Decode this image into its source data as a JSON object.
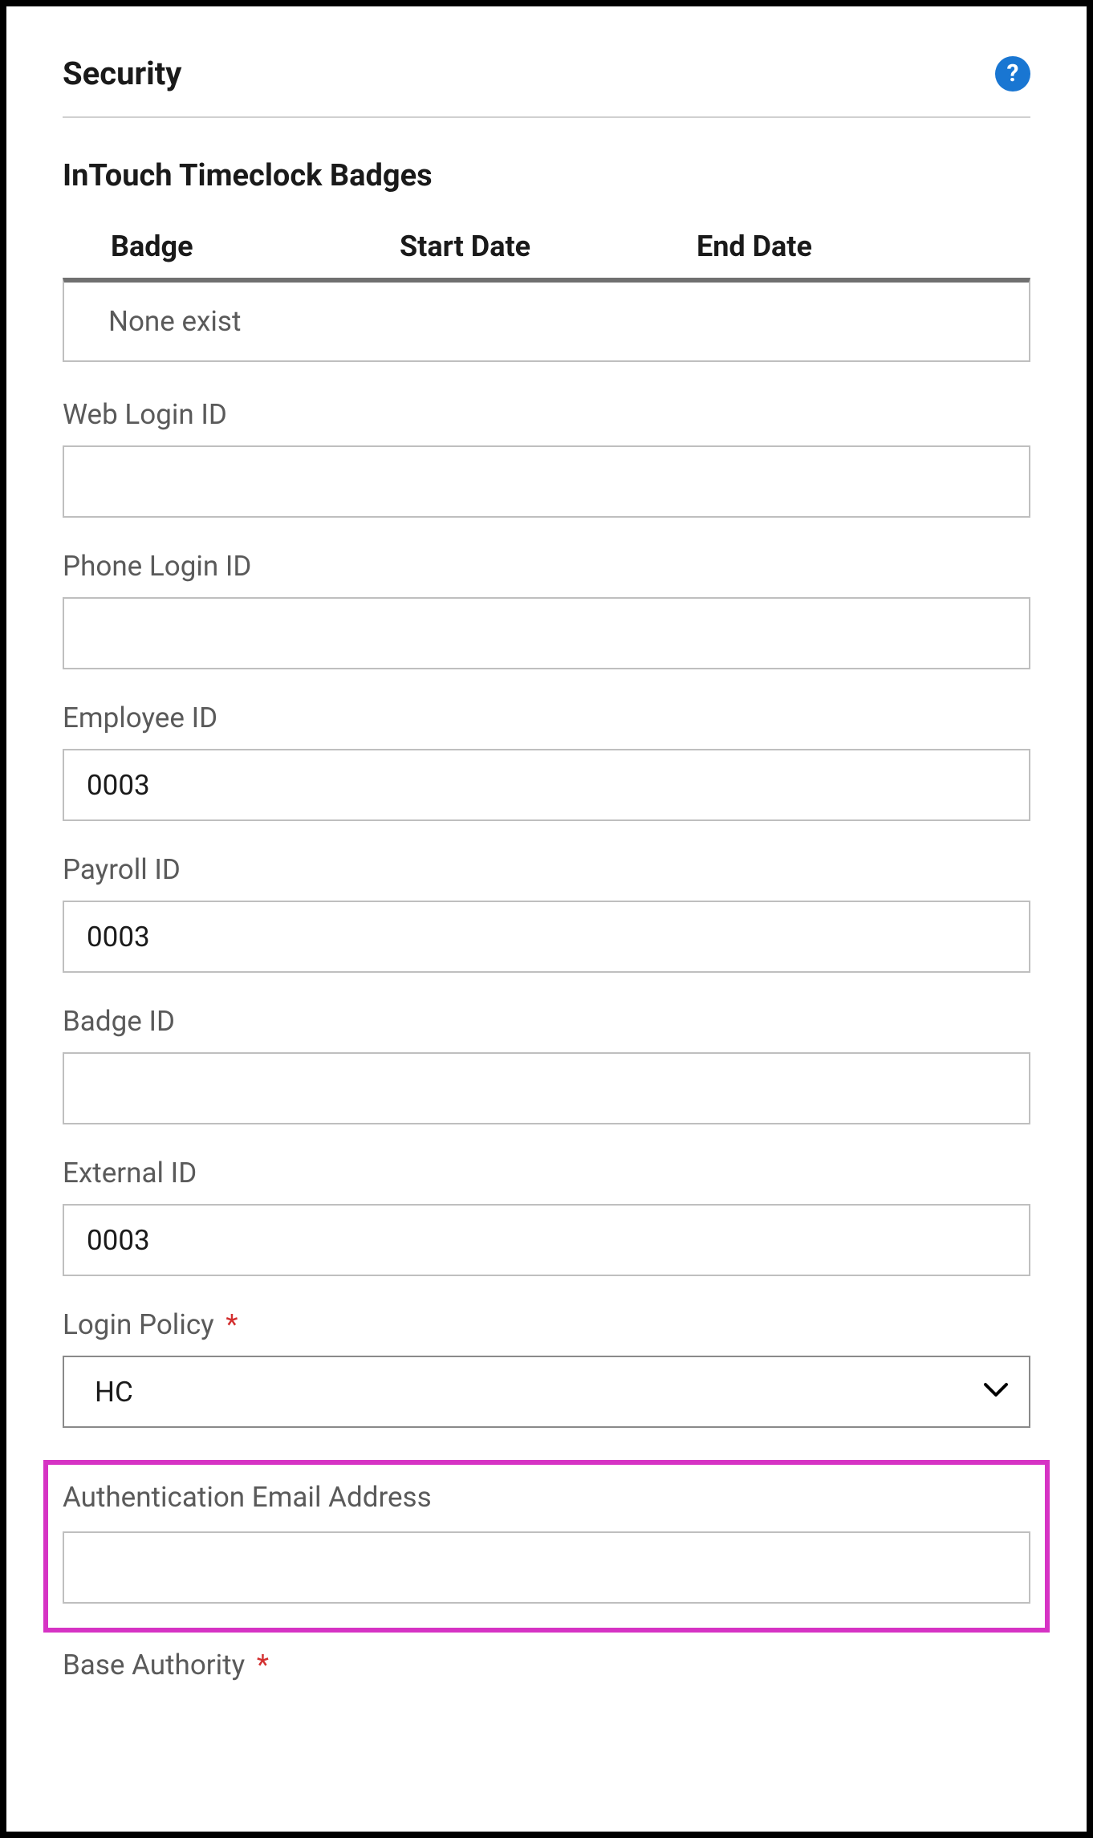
{
  "header": {
    "title": "Security"
  },
  "section": {
    "title": "InTouch Timeclock Badges",
    "table": {
      "columns": [
        "Badge",
        "Start Date",
        "End Date"
      ],
      "empty_text": "None exist"
    }
  },
  "fields": {
    "web_login_id": {
      "label": "Web Login ID",
      "value": ""
    },
    "phone_login_id": {
      "label": "Phone Login ID",
      "value": ""
    },
    "employee_id": {
      "label": "Employee ID",
      "value": "0003"
    },
    "payroll_id": {
      "label": "Payroll ID",
      "value": "0003"
    },
    "badge_id": {
      "label": "Badge ID",
      "value": ""
    },
    "external_id": {
      "label": "External ID",
      "value": "0003"
    },
    "login_policy": {
      "label": "Login Policy",
      "required": "*",
      "value": "HC"
    },
    "auth_email": {
      "label": "Authentication Email Address",
      "value": ""
    },
    "base_authority": {
      "label": "Base Authority",
      "required": "*"
    }
  }
}
